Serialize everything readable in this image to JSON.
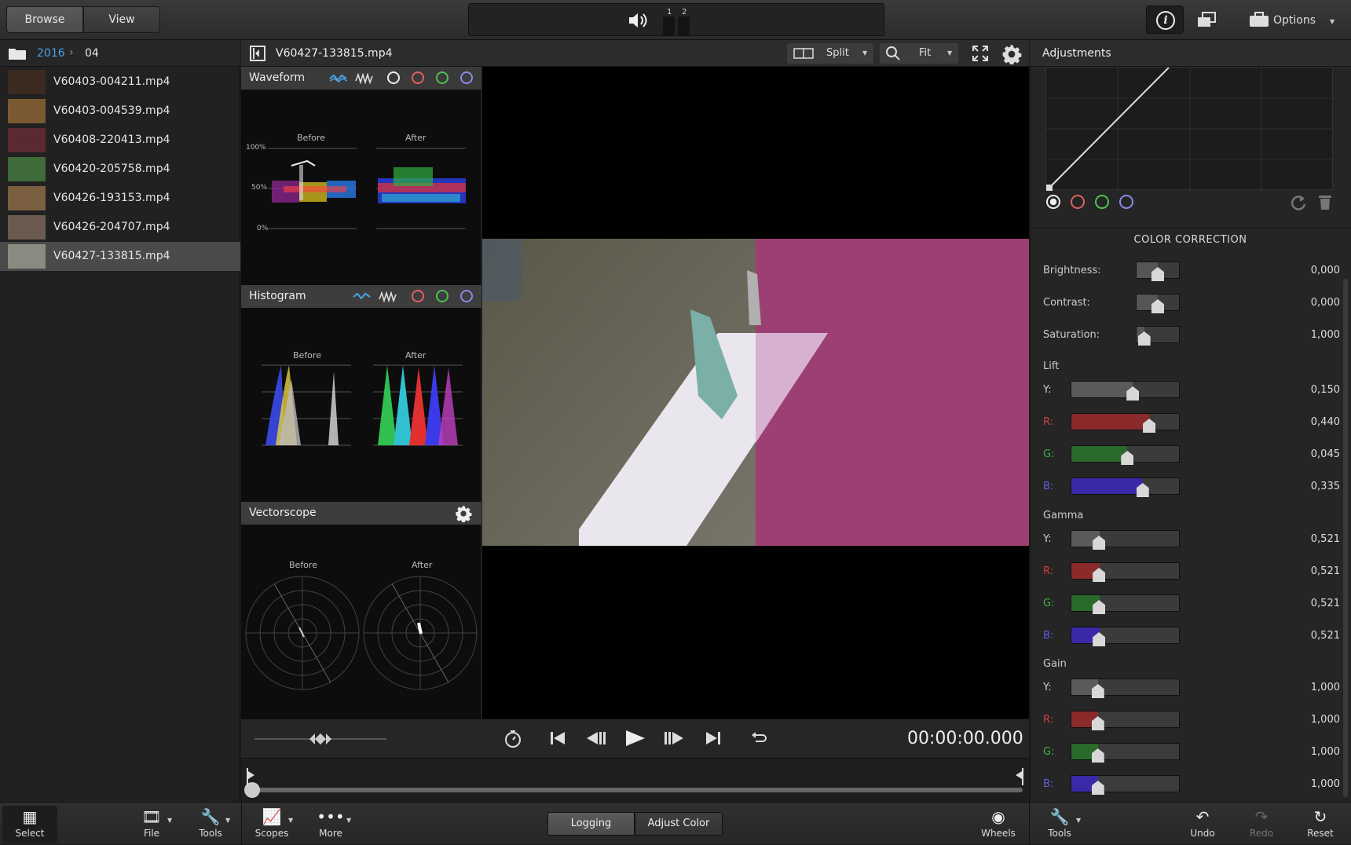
{
  "topbar": {
    "browse": "Browse",
    "view": "View",
    "meter1": "1",
    "meter2": "2",
    "options": "Options"
  },
  "breadcrumb": {
    "year": "2016",
    "month": "04"
  },
  "files": [
    {
      "name": "V60403-004211.mp4",
      "selected": false,
      "thumb": "#3a2a20"
    },
    {
      "name": "V60403-004539.mp4",
      "selected": false,
      "thumb": "#7a5a30"
    },
    {
      "name": "V60408-220413.mp4",
      "selected": false,
      "thumb": "#5a2a30"
    },
    {
      "name": "V60420-205758.mp4",
      "selected": false,
      "thumb": "#3f6a3a"
    },
    {
      "name": "V60426-193153.mp4",
      "selected": false,
      "thumb": "#7a6040"
    },
    {
      "name": "V60426-204707.mp4",
      "selected": false,
      "thumb": "#6a5a50"
    },
    {
      "name": "V60427-133815.mp4",
      "selected": true,
      "thumb": "#8a8a80"
    }
  ],
  "center": {
    "filename": "V60427-133815.mp4",
    "split": "Split",
    "fit": "Fit"
  },
  "scopes": {
    "waveform": {
      "title": "Waveform",
      "before": "Before",
      "after": "After",
      "ticks": [
        "100%",
        "50%",
        "0%"
      ]
    },
    "histogram": {
      "title": "Histogram",
      "before": "Before",
      "after": "After"
    },
    "vectorscope": {
      "title": "Vectorscope",
      "before": "Before",
      "after": "After"
    }
  },
  "transport": {
    "timecode": "00:00:00.000"
  },
  "adjustments": {
    "title": "Adjustments",
    "section": "COLOR CORRECTION",
    "basic": [
      {
        "label": "Brightness:",
        "value": "0,000",
        "pos": 0.5
      },
      {
        "label": "Contrast:",
        "value": "0,000",
        "pos": 0.5
      },
      {
        "label": "Saturation:",
        "value": "1,000",
        "pos": 0.19
      }
    ],
    "groups": [
      {
        "label": "Lift",
        "rows": [
          {
            "ch": "Y:",
            "value": "0,150",
            "pos": 0.57
          },
          {
            "ch": "R:",
            "value": "0,440",
            "pos": 0.72
          },
          {
            "ch": "G:",
            "value": "0,045",
            "pos": 0.52
          },
          {
            "ch": "B:",
            "value": "0,335",
            "pos": 0.66
          }
        ]
      },
      {
        "label": "Gamma",
        "rows": [
          {
            "ch": "Y:",
            "value": "0,521",
            "pos": 0.26
          },
          {
            "ch": "R:",
            "value": "0,521",
            "pos": 0.26
          },
          {
            "ch": "G:",
            "value": "0,521",
            "pos": 0.26
          },
          {
            "ch": "B:",
            "value": "0,521",
            "pos": 0.26
          }
        ]
      },
      {
        "label": "Gain",
        "rows": [
          {
            "ch": "Y:",
            "value": "1,000",
            "pos": 0.25
          },
          {
            "ch": "R:",
            "value": "1,000",
            "pos": 0.25
          },
          {
            "ch": "G:",
            "value": "1,000",
            "pos": 0.25
          },
          {
            "ch": "B:",
            "value": "1,000",
            "pos": 0.25
          }
        ]
      }
    ],
    "channel_colors": {
      "Y:": "#5a5a5a",
      "R:": "#8a2a2a",
      "G:": "#2a6a2a",
      "B:": "#3a2aa8"
    },
    "label_colors": {
      "Y:": "#cccccc",
      "R:": "#d04040",
      "G:": "#40b040",
      "B:": "#6060e0"
    }
  },
  "bottombar": {
    "select": "Select",
    "file": "File",
    "tools": "Tools",
    "scopes": "Scopes",
    "more": "More",
    "logging": "Logging",
    "adjust_color": "Adjust Color",
    "wheels": "Wheels",
    "tools2": "Tools",
    "undo": "Undo",
    "redo": "Redo",
    "reset": "Reset"
  }
}
